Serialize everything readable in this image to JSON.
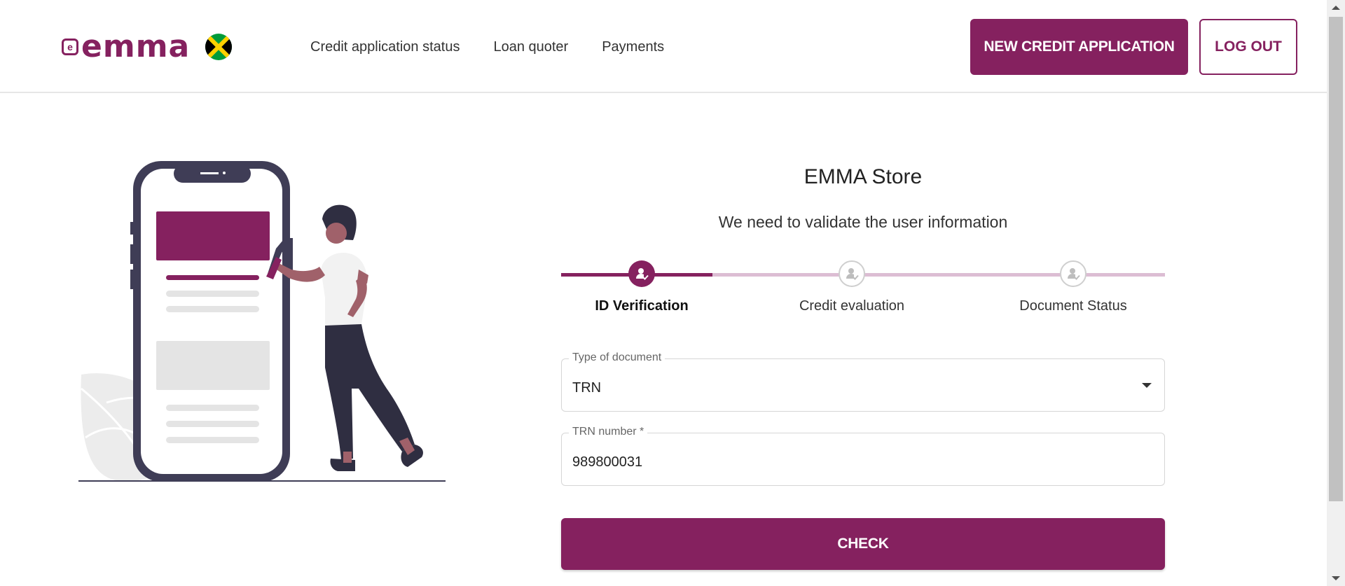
{
  "header": {
    "logo_text": "emma",
    "flag": "jamaica-flag",
    "nav": [
      {
        "label": "Credit application status"
      },
      {
        "label": "Loan quoter"
      },
      {
        "label": "Payments"
      }
    ],
    "new_credit_label": "NEW CREDIT APPLICATION",
    "logout_label": "LOG OUT"
  },
  "main": {
    "store_title": "EMMA Store",
    "subtitle": "We need to validate the user information",
    "steps": [
      {
        "label": "ID Verification",
        "state": "active",
        "icon": "user-check-icon"
      },
      {
        "label": "Credit evaluation",
        "state": "inactive",
        "icon": "user-check-icon"
      },
      {
        "label": "Document Status",
        "state": "inactive",
        "icon": "user-check-icon"
      }
    ],
    "document_type": {
      "label": "Type of document",
      "value": "TRN"
    },
    "trn_number": {
      "label": "TRN number *",
      "value": "989800031"
    },
    "check_label": "CHECK"
  },
  "colors": {
    "brand": "#85215f",
    "brand_light": "#dcbdd3"
  }
}
